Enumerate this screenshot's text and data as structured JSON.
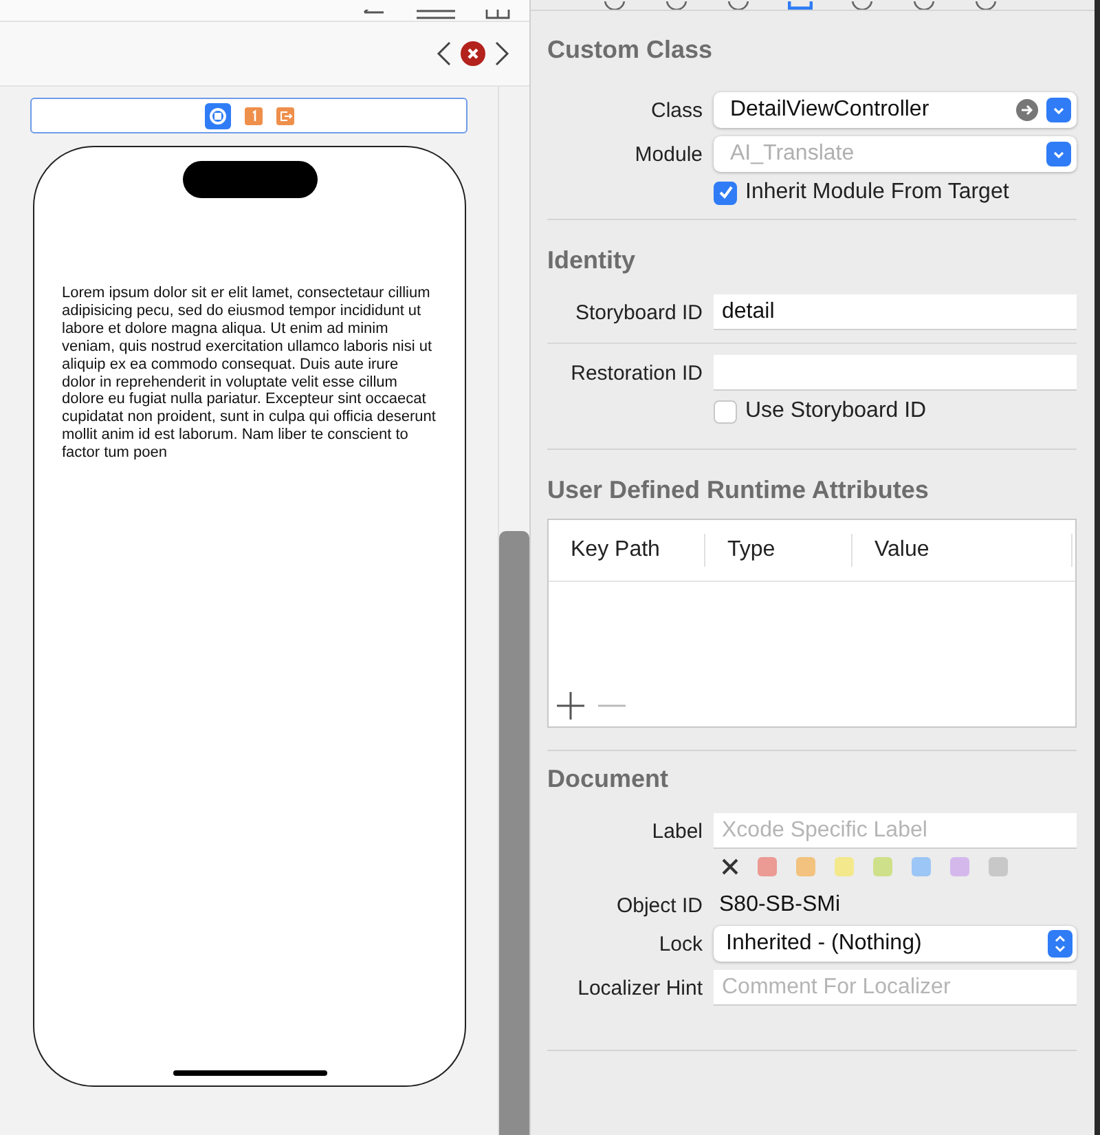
{
  "canvas": {
    "phone": {
      "text": "Lorem ipsum dolor sit er elit lamet, consectetaur cillium adipisicing pecu, sed do eiusmod tempor incididunt ut labore et dolore magna aliqua. Ut enim ad minim veniam, quis nostrud exercitation ullamco laboris nisi ut aliquip ex ea commodo consequat. Duis aute irure dolor in reprehenderit in voluptate velit esse cillum dolore eu fugiat nulla pariatur. Excepteur sint occaecat cupidatat non proident, sunt in culpa qui officia deserunt mollit anim id est laborum. Nam liber te conscient to factor tum poen"
    }
  },
  "inspector": {
    "custom_class": {
      "title": "Custom Class",
      "class": {
        "label": "Class",
        "value": "DetailViewController"
      },
      "module": {
        "label": "Module",
        "placeholder": "AI_Translate"
      },
      "inherit": {
        "label": "Inherit Module From Target",
        "checked": true
      }
    },
    "identity": {
      "title": "Identity",
      "storyboard_id": {
        "label": "Storyboard ID",
        "value": "detail"
      },
      "restoration_id": {
        "label": "Restoration ID"
      },
      "use_storyboard_id": {
        "label": "Use Storyboard ID",
        "checked": false
      }
    },
    "runtime_attributes": {
      "title": "User Defined Runtime Attributes",
      "columns": [
        "Key Path",
        "Type",
        "Value"
      ]
    },
    "document": {
      "title": "Document",
      "label": {
        "label": "Label",
        "placeholder": "Xcode Specific Label"
      },
      "colors": [
        {
          "color": "#ec9a94"
        },
        {
          "color": "#f2c27e"
        },
        {
          "color": "#f3e98c"
        },
        {
          "color": "#cfe08a"
        },
        {
          "color": "#9cc6f5"
        },
        {
          "color": "#d4b8ec"
        },
        {
          "color": "#c8c8c8"
        }
      ],
      "object_id": {
        "label": "Object ID",
        "value": "S80-SB-SMi"
      },
      "lock": {
        "label": "Lock",
        "value": "Inherited - (Nothing)"
      },
      "localizer_hint": {
        "label": "Localizer Hint",
        "placeholder": "Comment For Localizer"
      }
    }
  }
}
